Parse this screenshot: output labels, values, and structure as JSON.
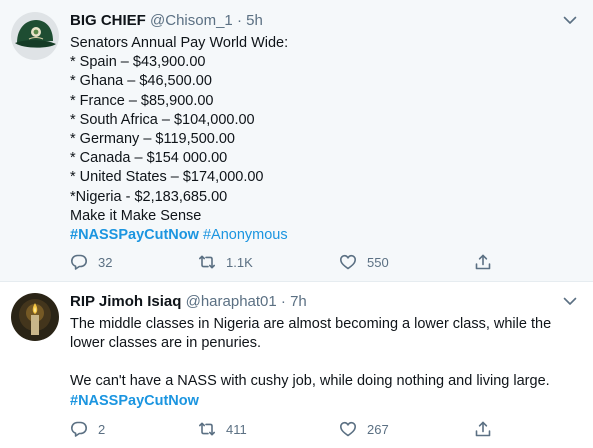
{
  "tweets": [
    {
      "name": "BIG CHIEF",
      "handle": "@Chisom_1",
      "separator": "·",
      "time": "5h",
      "lines": [
        "Senators Annual Pay World Wide:",
        "* Spain – $43,900.00",
        "* Ghana – $46,500.00",
        "* France – $85,900.00",
        "* South Africa – $104,000.00",
        "* Germany – $119,500.00",
        "* Canada – $154 000.00",
        "* United States – $174,000.00",
        "*Nigeria - $2,183,685.00",
        "Make it Make Sense"
      ],
      "hashtags": [
        "#NASSPayCutNow",
        "#Anonymous"
      ],
      "replies": "32",
      "retweets": "1.1K",
      "likes": "550",
      "avatar_icon": "cap-icon"
    },
    {
      "name": "RIP Jimoh Isiaq",
      "handle": "@haraphat01",
      "separator": "·",
      "time": "7h",
      "paragraph1": "The middle classes in Nigeria are almost becoming a lower class, while the lower classes are in penuries.",
      "paragraph2": "We can't have a NASS with cushy job, while doing nothing and living large.",
      "hashtag": "#NASSPayCutNow",
      "replies": "2",
      "retweets": "411",
      "likes": "267",
      "avatar_icon": "candle-icon"
    }
  ],
  "icons": {
    "caret": "chevron-down-icon",
    "reply": "reply-icon",
    "retweet": "retweet-icon",
    "like": "heart-icon",
    "share": "share-icon"
  },
  "colors": {
    "hashtag": "#1b95e0",
    "secondary_text": "#5b7083",
    "highlight_background": "#f5f8fa",
    "divider": "#e6ecf0"
  }
}
